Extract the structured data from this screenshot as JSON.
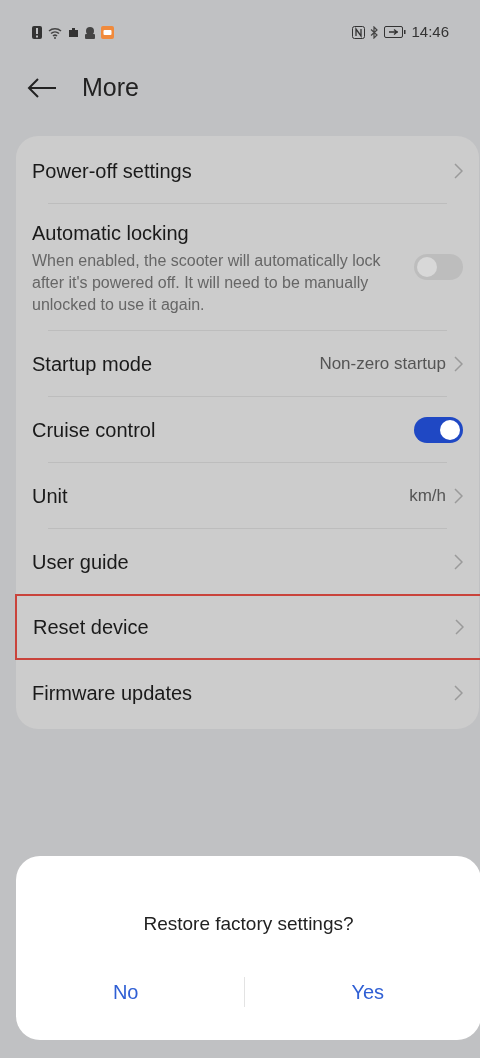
{
  "status_bar": {
    "time": "14:46"
  },
  "header": {
    "title": "More"
  },
  "settings": [
    {
      "kind": "link",
      "label": "Power-off settings",
      "highlighted": false
    },
    {
      "kind": "toggle",
      "label": "Automatic locking",
      "description": "When enabled, the scooter will automatically lock after it's powered off. It will need to be manually unlocked to use it again.",
      "on": false
    },
    {
      "kind": "link",
      "label": "Startup mode",
      "value": "Non-zero startup",
      "highlighted": false
    },
    {
      "kind": "toggle",
      "label": "Cruise control",
      "on": true
    },
    {
      "kind": "link",
      "label": "Unit",
      "value": "km/h",
      "highlighted": false
    },
    {
      "kind": "link",
      "label": "User guide",
      "highlighted": false
    },
    {
      "kind": "link",
      "label": "Reset device",
      "highlighted": true
    },
    {
      "kind": "link",
      "label": "Firmware updates",
      "highlighted": false
    }
  ],
  "dialog": {
    "title": "Restore factory settings?",
    "buttons": [
      "No",
      "Yes"
    ]
  }
}
